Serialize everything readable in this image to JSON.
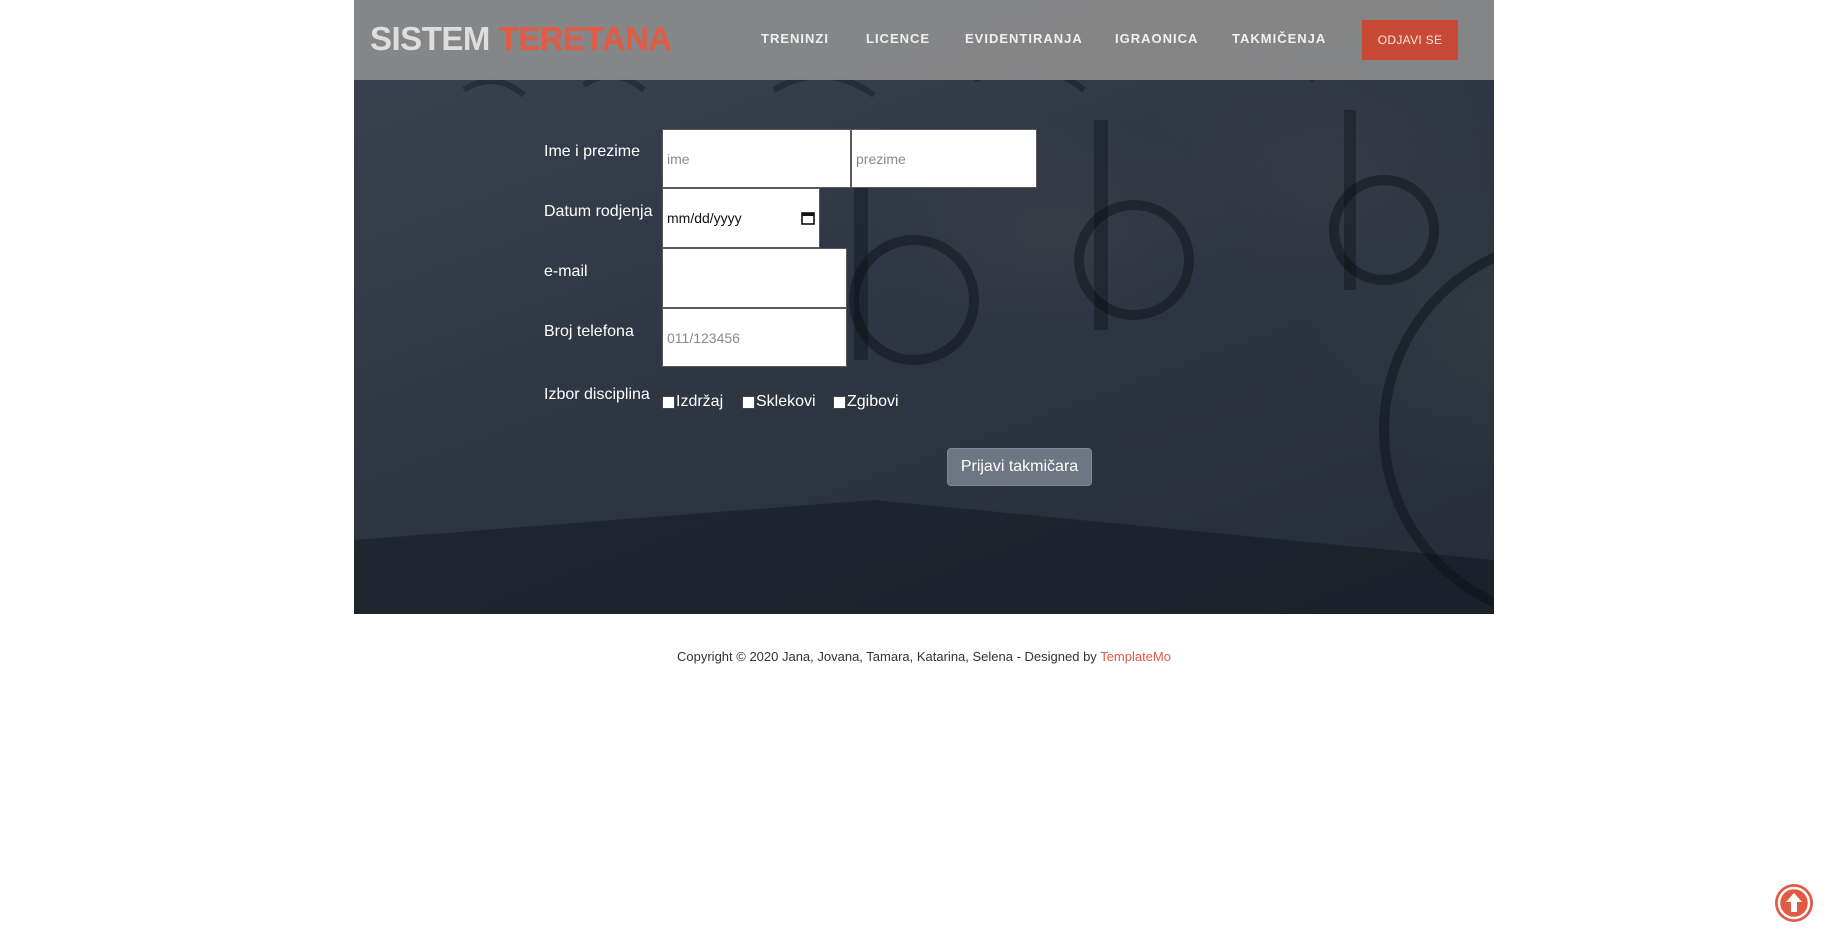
{
  "brand": {
    "part1": "SISTEM",
    "part2": "TERETANA"
  },
  "nav": {
    "items": [
      "TRENINZI",
      "LICENCE",
      "EVIDENTIRANJA",
      "IGRAONICA",
      "TAKMIČENJA"
    ],
    "logout_label": "ODJAVI SE"
  },
  "form": {
    "labels": {
      "name": "Ime i prezime",
      "birth": "Datum rodjenja",
      "email": "e-mail",
      "phone": "Broj telefona",
      "disciplines": "Izbor disciplina"
    },
    "placeholders": {
      "first_name": "ime",
      "last_name": "prezime",
      "phone": "011/123456"
    },
    "date_format": "mm/dd/yyyy",
    "disciplines": [
      "Izdržaj",
      "Sklekovi",
      "Zgibovi"
    ],
    "submit_label": "Prijavi takmičara"
  },
  "footer": {
    "text": "Copyright © 2020 Jana, Jovana, Tamara, Katarina, Selena - Designed by ",
    "link": "TemplateMo"
  },
  "colors": {
    "accent": "#e15a43",
    "logout_bg": "#c84a36",
    "header_bg": "#8c8c8c",
    "hero_bg": "#2f3744"
  },
  "icons": {
    "calendar": "calendar-icon",
    "scroll_top": "arrow-up-circle-icon"
  }
}
